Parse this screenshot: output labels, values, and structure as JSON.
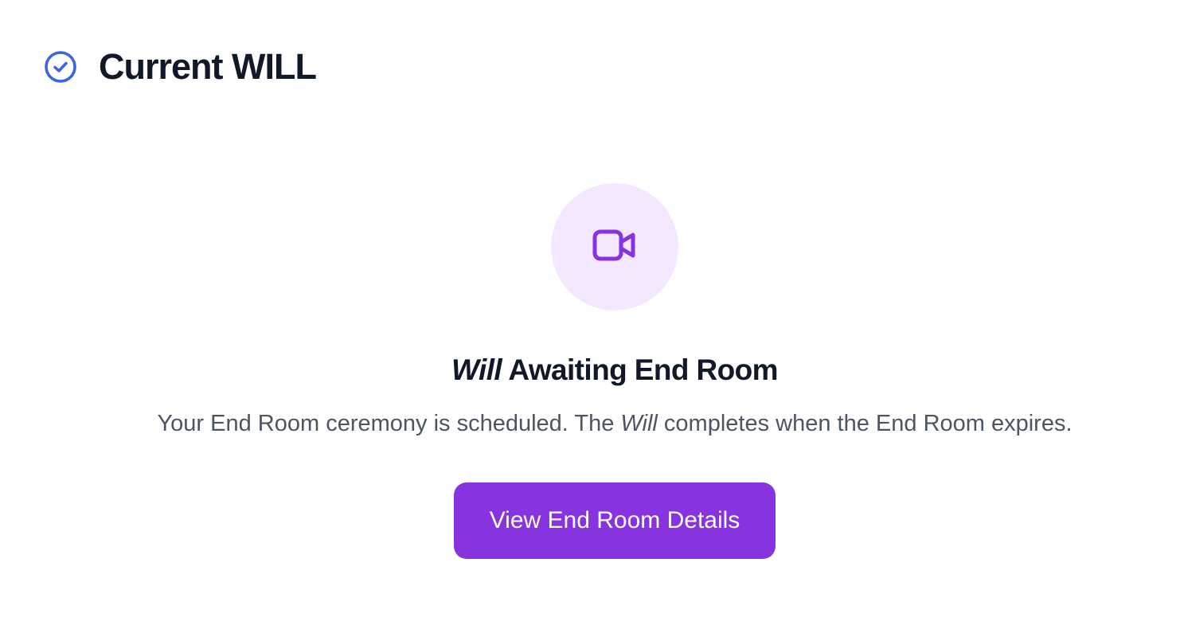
{
  "header": {
    "title": "Current WILL",
    "icon": "check-circle-icon",
    "icon_color": "#3b63e6"
  },
  "status": {
    "icon": "video-camera-icon",
    "icon_color": "#8734e0",
    "circle_color": "#f3e8ff",
    "title_emphasis": "Will",
    "title_rest": " Awaiting End Room",
    "description_before": "Your End Room ceremony is scheduled. The ",
    "description_emphasis": "Will",
    "description_after": " completes when the End Room expires."
  },
  "actions": {
    "primary_label": "View End Room Details",
    "primary_color": "#8734e0"
  }
}
